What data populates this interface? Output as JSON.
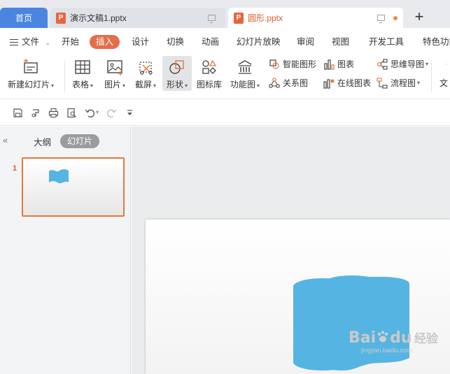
{
  "tabs": {
    "home": "首页",
    "doc1": "演示文稿1.pptx",
    "doc2": "圆形.pptx",
    "file_badge": "P"
  },
  "menu": {
    "file": "文件",
    "items": [
      "开始",
      "插入",
      "设计",
      "切换",
      "动画",
      "幻灯片放映",
      "审阅",
      "视图",
      "开发工具",
      "特色功能"
    ],
    "active_index": 1
  },
  "ribbon": {
    "new_slide": "新建幻灯片",
    "table": "表格",
    "picture": "图片",
    "screenshot": "截屏",
    "shape": "形状",
    "icon_lib": "图标库",
    "function_chart": "功能图",
    "smart_shape": "智能图形",
    "chart": "图表",
    "relation": "关系图",
    "online_chart": "在线图表",
    "mind_map": "思维导图",
    "flowchart": "流程图",
    "text_partial": "文"
  },
  "left_panel": {
    "outline_tab": "大纲",
    "slides_tab": "幻灯片",
    "slide_number": "1"
  },
  "watermark": {
    "brand": "Bai",
    "brand_suffix": "du",
    "cn": "经验",
    "url": "jingyan.baidu.com"
  },
  "colors": {
    "accent": "#e56d4c",
    "home_tab": "#4a86e0",
    "shape_fill": "#56b4e3"
  }
}
